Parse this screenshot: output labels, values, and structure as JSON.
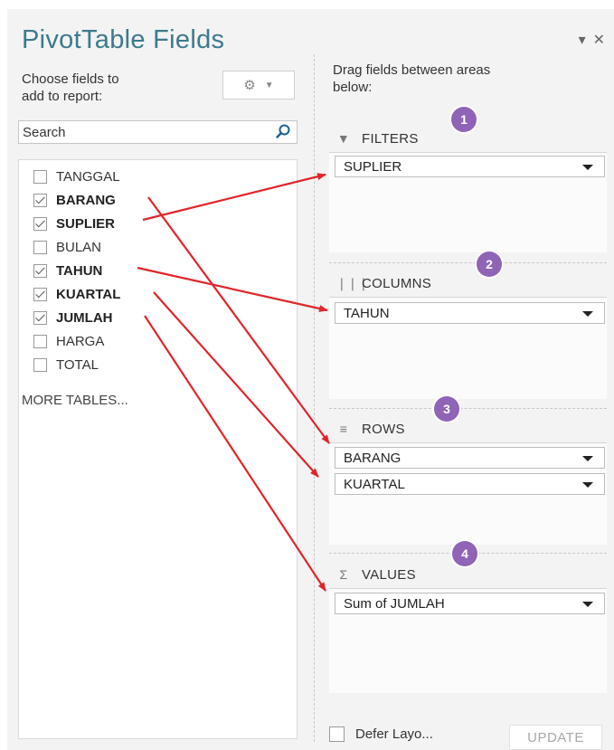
{
  "panel": {
    "title": "PivotTable Fields",
    "dropdown_icon": "chevron-down-icon",
    "close_icon": "close-icon",
    "choose_label_line1": "Choose fields to",
    "choose_label_line2": "add to report:",
    "tools_icon": "gear-icon",
    "search_placeholder": "Search",
    "fields": [
      {
        "label": "TANGGAL",
        "checked": false
      },
      {
        "label": "BARANG",
        "checked": true
      },
      {
        "label": "SUPLIER",
        "checked": true
      },
      {
        "label": "BULAN",
        "checked": false
      },
      {
        "label": "TAHUN",
        "checked": true
      },
      {
        "label": "KUARTAL",
        "checked": true
      },
      {
        "label": "JUMLAH",
        "checked": true
      },
      {
        "label": "HARGA",
        "checked": false
      },
      {
        "label": "TOTAL",
        "checked": false
      }
    ],
    "more_tables": "MORE TABLES...",
    "drag_label_line1": "Drag fields between areas",
    "drag_label_line2": "below:"
  },
  "areas": {
    "filters": {
      "label": "FILTERS",
      "badge": "1",
      "items": [
        "SUPLIER"
      ]
    },
    "columns": {
      "label": "COLUMNS",
      "badge": "2",
      "items": [
        "TAHUN"
      ]
    },
    "rows": {
      "label": "ROWS",
      "badge": "3",
      "items": [
        "BARANG",
        "KUARTAL"
      ]
    },
    "values": {
      "label": "VALUES",
      "badge": "4",
      "items": [
        "Sum of JUMLAH"
      ]
    }
  },
  "footer": {
    "defer_label": "Defer Layo...",
    "update_label": "UPDATE"
  },
  "colors": {
    "title": "#3c7a8c",
    "badge": "#8f63b6",
    "arrow": "#e0262b"
  }
}
